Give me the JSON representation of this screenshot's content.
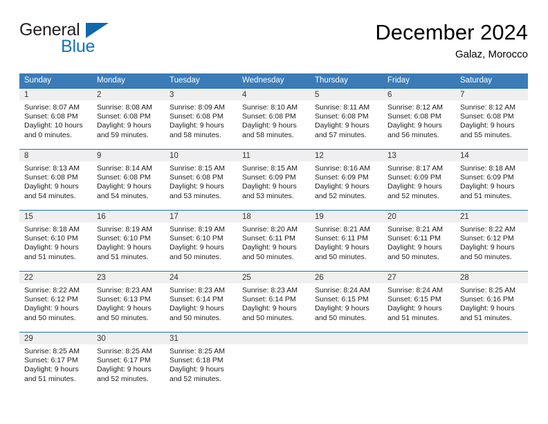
{
  "brand": {
    "name_part1": "General",
    "name_part2": "Blue",
    "flag_icon": "triangle-flag-icon"
  },
  "header": {
    "month_title": "December 2024",
    "location": "Galaz, Morocco"
  },
  "colors": {
    "header_blue": "#3b7cb8",
    "row_border_blue": "#1d6fb5",
    "date_band_gray": "#efefef",
    "brand_blue": "#1273c0"
  },
  "weekday_headers": [
    "Sunday",
    "Monday",
    "Tuesday",
    "Wednesday",
    "Thursday",
    "Friday",
    "Saturday"
  ],
  "weeks": [
    [
      {
        "day": "1",
        "sunrise": "Sunrise: 8:07 AM",
        "sunset": "Sunset: 6:08 PM",
        "daylight_line1": "Daylight: 10 hours",
        "daylight_line2": "and 0 minutes."
      },
      {
        "day": "2",
        "sunrise": "Sunrise: 8:08 AM",
        "sunset": "Sunset: 6:08 PM",
        "daylight_line1": "Daylight: 9 hours",
        "daylight_line2": "and 59 minutes."
      },
      {
        "day": "3",
        "sunrise": "Sunrise: 8:09 AM",
        "sunset": "Sunset: 6:08 PM",
        "daylight_line1": "Daylight: 9 hours",
        "daylight_line2": "and 58 minutes."
      },
      {
        "day": "4",
        "sunrise": "Sunrise: 8:10 AM",
        "sunset": "Sunset: 6:08 PM",
        "daylight_line1": "Daylight: 9 hours",
        "daylight_line2": "and 58 minutes."
      },
      {
        "day": "5",
        "sunrise": "Sunrise: 8:11 AM",
        "sunset": "Sunset: 6:08 PM",
        "daylight_line1": "Daylight: 9 hours",
        "daylight_line2": "and 57 minutes."
      },
      {
        "day": "6",
        "sunrise": "Sunrise: 8:12 AM",
        "sunset": "Sunset: 6:08 PM",
        "daylight_line1": "Daylight: 9 hours",
        "daylight_line2": "and 56 minutes."
      },
      {
        "day": "7",
        "sunrise": "Sunrise: 8:12 AM",
        "sunset": "Sunset: 6:08 PM",
        "daylight_line1": "Daylight: 9 hours",
        "daylight_line2": "and 55 minutes."
      }
    ],
    [
      {
        "day": "8",
        "sunrise": "Sunrise: 8:13 AM",
        "sunset": "Sunset: 6:08 PM",
        "daylight_line1": "Daylight: 9 hours",
        "daylight_line2": "and 54 minutes."
      },
      {
        "day": "9",
        "sunrise": "Sunrise: 8:14 AM",
        "sunset": "Sunset: 6:08 PM",
        "daylight_line1": "Daylight: 9 hours",
        "daylight_line2": "and 54 minutes."
      },
      {
        "day": "10",
        "sunrise": "Sunrise: 8:15 AM",
        "sunset": "Sunset: 6:08 PM",
        "daylight_line1": "Daylight: 9 hours",
        "daylight_line2": "and 53 minutes."
      },
      {
        "day": "11",
        "sunrise": "Sunrise: 8:15 AM",
        "sunset": "Sunset: 6:09 PM",
        "daylight_line1": "Daylight: 9 hours",
        "daylight_line2": "and 53 minutes."
      },
      {
        "day": "12",
        "sunrise": "Sunrise: 8:16 AM",
        "sunset": "Sunset: 6:09 PM",
        "daylight_line1": "Daylight: 9 hours",
        "daylight_line2": "and 52 minutes."
      },
      {
        "day": "13",
        "sunrise": "Sunrise: 8:17 AM",
        "sunset": "Sunset: 6:09 PM",
        "daylight_line1": "Daylight: 9 hours",
        "daylight_line2": "and 52 minutes."
      },
      {
        "day": "14",
        "sunrise": "Sunrise: 8:18 AM",
        "sunset": "Sunset: 6:09 PM",
        "daylight_line1": "Daylight: 9 hours",
        "daylight_line2": "and 51 minutes."
      }
    ],
    [
      {
        "day": "15",
        "sunrise": "Sunrise: 8:18 AM",
        "sunset": "Sunset: 6:10 PM",
        "daylight_line1": "Daylight: 9 hours",
        "daylight_line2": "and 51 minutes."
      },
      {
        "day": "16",
        "sunrise": "Sunrise: 8:19 AM",
        "sunset": "Sunset: 6:10 PM",
        "daylight_line1": "Daylight: 9 hours",
        "daylight_line2": "and 51 minutes."
      },
      {
        "day": "17",
        "sunrise": "Sunrise: 8:19 AM",
        "sunset": "Sunset: 6:10 PM",
        "daylight_line1": "Daylight: 9 hours",
        "daylight_line2": "and 50 minutes."
      },
      {
        "day": "18",
        "sunrise": "Sunrise: 8:20 AM",
        "sunset": "Sunset: 6:11 PM",
        "daylight_line1": "Daylight: 9 hours",
        "daylight_line2": "and 50 minutes."
      },
      {
        "day": "19",
        "sunrise": "Sunrise: 8:21 AM",
        "sunset": "Sunset: 6:11 PM",
        "daylight_line1": "Daylight: 9 hours",
        "daylight_line2": "and 50 minutes."
      },
      {
        "day": "20",
        "sunrise": "Sunrise: 8:21 AM",
        "sunset": "Sunset: 6:11 PM",
        "daylight_line1": "Daylight: 9 hours",
        "daylight_line2": "and 50 minutes."
      },
      {
        "day": "21",
        "sunrise": "Sunrise: 8:22 AM",
        "sunset": "Sunset: 6:12 PM",
        "daylight_line1": "Daylight: 9 hours",
        "daylight_line2": "and 50 minutes."
      }
    ],
    [
      {
        "day": "22",
        "sunrise": "Sunrise: 8:22 AM",
        "sunset": "Sunset: 6:12 PM",
        "daylight_line1": "Daylight: 9 hours",
        "daylight_line2": "and 50 minutes."
      },
      {
        "day": "23",
        "sunrise": "Sunrise: 8:23 AM",
        "sunset": "Sunset: 6:13 PM",
        "daylight_line1": "Daylight: 9 hours",
        "daylight_line2": "and 50 minutes."
      },
      {
        "day": "24",
        "sunrise": "Sunrise: 8:23 AM",
        "sunset": "Sunset: 6:14 PM",
        "daylight_line1": "Daylight: 9 hours",
        "daylight_line2": "and 50 minutes."
      },
      {
        "day": "25",
        "sunrise": "Sunrise: 8:23 AM",
        "sunset": "Sunset: 6:14 PM",
        "daylight_line1": "Daylight: 9 hours",
        "daylight_line2": "and 50 minutes."
      },
      {
        "day": "26",
        "sunrise": "Sunrise: 8:24 AM",
        "sunset": "Sunset: 6:15 PM",
        "daylight_line1": "Daylight: 9 hours",
        "daylight_line2": "and 50 minutes."
      },
      {
        "day": "27",
        "sunrise": "Sunrise: 8:24 AM",
        "sunset": "Sunset: 6:15 PM",
        "daylight_line1": "Daylight: 9 hours",
        "daylight_line2": "and 51 minutes."
      },
      {
        "day": "28",
        "sunrise": "Sunrise: 8:25 AM",
        "sunset": "Sunset: 6:16 PM",
        "daylight_line1": "Daylight: 9 hours",
        "daylight_line2": "and 51 minutes."
      }
    ],
    [
      {
        "day": "29",
        "sunrise": "Sunrise: 8:25 AM",
        "sunset": "Sunset: 6:17 PM",
        "daylight_line1": "Daylight: 9 hours",
        "daylight_line2": "and 51 minutes."
      },
      {
        "day": "30",
        "sunrise": "Sunrise: 8:25 AM",
        "sunset": "Sunset: 6:17 PM",
        "daylight_line1": "Daylight: 9 hours",
        "daylight_line2": "and 52 minutes."
      },
      {
        "day": "31",
        "sunrise": "Sunrise: 8:25 AM",
        "sunset": "Sunset: 6:18 PM",
        "daylight_line1": "Daylight: 9 hours",
        "daylight_line2": "and 52 minutes."
      },
      {
        "day": "",
        "sunrise": "",
        "sunset": "",
        "daylight_line1": "",
        "daylight_line2": ""
      },
      {
        "day": "",
        "sunrise": "",
        "sunset": "",
        "daylight_line1": "",
        "daylight_line2": ""
      },
      {
        "day": "",
        "sunrise": "",
        "sunset": "",
        "daylight_line1": "",
        "daylight_line2": ""
      },
      {
        "day": "",
        "sunrise": "",
        "sunset": "",
        "daylight_line1": "",
        "daylight_line2": ""
      }
    ]
  ]
}
